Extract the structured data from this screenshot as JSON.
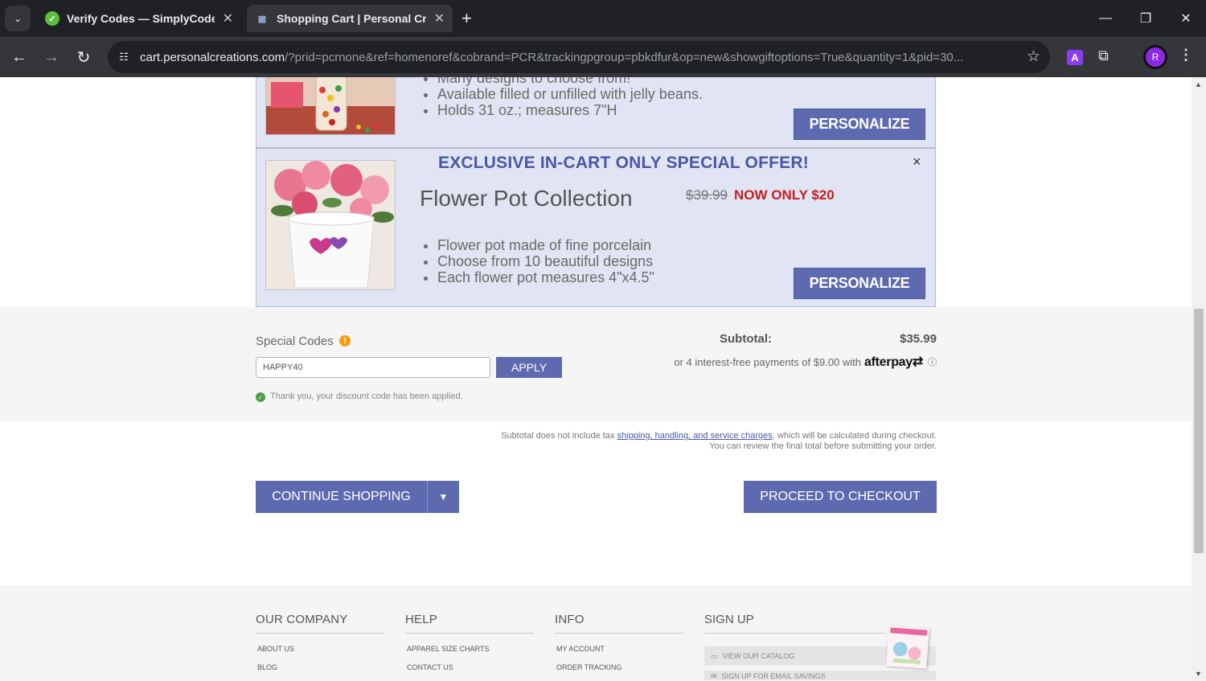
{
  "browser": {
    "tabs": [
      {
        "title": "Verify Codes — SimplyCodes",
        "active": false
      },
      {
        "title": "Shopping Cart | Personal Creat",
        "active": true
      }
    ],
    "url_host": "cart.personalcreations.com",
    "url_path": "/?prid=pcrnone&ref=homenoref&cobrand=PCR&trackingpgroup=pbkdfur&op=new&showgiftoptions=True&quantity=1&pid=30...",
    "profile_initial": "R",
    "extension_letter": "A"
  },
  "offer1": {
    "bullets": [
      "Many designs to choose from!",
      "Available filled or unfilled with jelly beans.",
      "Holds 31 oz.; measures 7\"H"
    ],
    "button": "PERSONALIZE"
  },
  "offer2": {
    "banner": "EXCLUSIVE IN-CART ONLY SPECIAL OFFER!",
    "close": "×",
    "title": "Flower Pot Collection",
    "price_old": "$39.99",
    "price_new": "NOW ONLY $20",
    "bullets": [
      "Flower pot made of fine porcelain",
      "Choose from 10 beautiful designs",
      "Each flower pot measures 4\"x4.5\""
    ],
    "button": "PERSONALIZE"
  },
  "codes": {
    "label": "Special Codes",
    "input_value": "HAPPY40",
    "apply": "APPLY",
    "applied_message": "Thank you, your discount code has been applied."
  },
  "summary": {
    "subtotal_label": "Subtotal:",
    "subtotal_value": "$35.99",
    "afterpay_text": "or 4 interest-free payments of $9.00 with",
    "afterpay_brand": "afterpay"
  },
  "tax_note": {
    "prefix": "Subtotal does not include tax",
    "link": "shipping, handling, and service charges",
    "suffix": ", which will be calculated during checkout.",
    "line2": "You can review the final total before submitting your order."
  },
  "actions": {
    "continue": "CONTINUE SHOPPING",
    "checkout": "PROCEED TO CHECKOUT"
  },
  "footer": {
    "columns": [
      {
        "heading": "OUR COMPANY",
        "links": [
          "ABOUT US",
          "BLOG"
        ]
      },
      {
        "heading": "HELP",
        "links": [
          "APPAREL SIZE CHARTS",
          "CONTACT US"
        ]
      },
      {
        "heading": "INFO",
        "links": [
          "MY ACCOUNT",
          "ORDER TRACKING"
        ]
      }
    ],
    "signup": {
      "heading": "SIGN UP",
      "catalog": "VIEW OUR CATALOG",
      "email": "SIGN UP FOR EMAIL SAVINGS"
    }
  },
  "colors": {
    "accent": "#5d6ab0",
    "offer_bg": "#e1e4f2",
    "price_red": "#c41f1f",
    "chrome_dark": "#202124"
  }
}
